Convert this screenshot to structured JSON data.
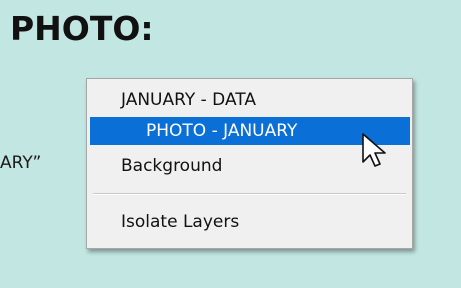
{
  "heading": "PHOTO:",
  "side_label": "ARY”",
  "context_menu": {
    "items": [
      {
        "label": "JANUARY - DATA"
      },
      {
        "label": "PHOTO - JANUARY",
        "highlighted": true
      },
      {
        "label": "Background"
      },
      {
        "label": "Isolate Layers"
      }
    ]
  },
  "colors": {
    "background": "#c2e6e2",
    "highlight": "#0a6fd6",
    "menu_background": "#f0f0f0"
  },
  "icons": {
    "cursor": "arrow-cursor-icon"
  }
}
